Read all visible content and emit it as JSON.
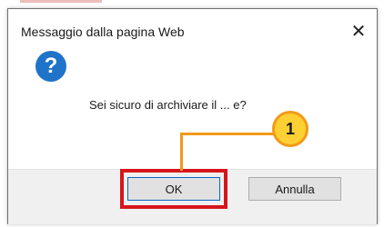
{
  "dialog": {
    "title": "Messaggio dalla pagina Web",
    "close_glyph": "✕",
    "message": "Sei sicuro di archiviare il ... e?",
    "question_glyph": "?",
    "icon": "question-icon"
  },
  "buttons": {
    "ok_label": "OK",
    "cancel_label": "Annulla"
  },
  "annotation": {
    "step_number": "1",
    "highlight_color": "#d6151b",
    "callout_color": "#f29a1a",
    "badge_fill": "#ffd033"
  },
  "colors": {
    "icon_blue": "#1f73c9",
    "footer_bg": "#f0f0f0"
  }
}
